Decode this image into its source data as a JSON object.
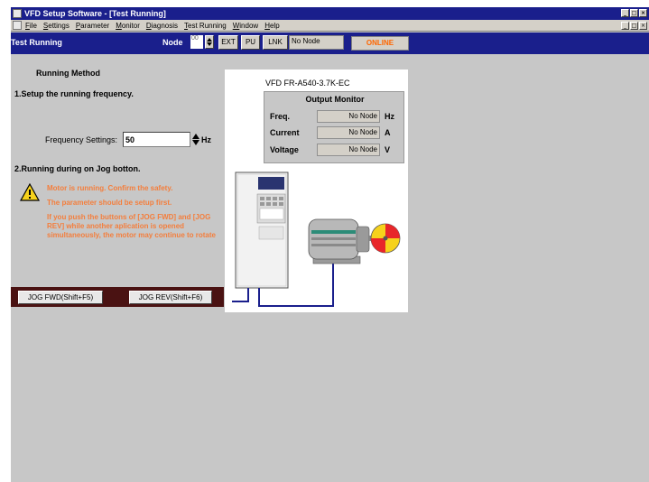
{
  "window": {
    "title": "VFD Setup Software - [Test Running]",
    "controls": [
      "_",
      "□",
      "×"
    ]
  },
  "menu": {
    "items": [
      "File",
      "Settings",
      "Parameter",
      "Monitor",
      "Diagnosis",
      "Test Running",
      "Window",
      "Help"
    ],
    "mdi_controls": [
      "_",
      "□",
      "×"
    ]
  },
  "toolbar": {
    "window_title": "Test Running",
    "node_label": "Node",
    "node_value": "00",
    "ext_label": "EXT",
    "pu_label": "PU",
    "lnk_label": "LNK",
    "node_status": "No Node",
    "online_label": "ONLINE"
  },
  "running": {
    "heading": "Running Method",
    "step1": "1.Setup the running frequency.",
    "freq_label": "Frequency Settings:",
    "freq_value": "50",
    "freq_unit": "Hz",
    "step2": "2.Running during on Jog botton.",
    "warnings": [
      "Motor is running. Confirm the safety.",
      "The parameter should be setup first.",
      "If you push the buttons of [JOG FWD] and [JOG REV] while another aplication is opened simultaneously, the motor may continue to rotate"
    ],
    "jog_fwd": "JOG FWD(Shift+F5)",
    "jog_rev": "JOG REV(Shift+F6)"
  },
  "monitor": {
    "model": "VFD FR-A540-3.7K-EC",
    "title": "Output Monitor",
    "rows": [
      {
        "label": "Freq.",
        "value": "No Node",
        "unit": "Hz"
      },
      {
        "label": "Current",
        "value": "No Node",
        "unit": "A"
      },
      {
        "label": "Voltage",
        "value": "No Node",
        "unit": "V"
      }
    ]
  },
  "colors": {
    "title_bar": "#1a1f8c",
    "warning_text": "#f47e3c",
    "online_text": "#ff6600",
    "jog_bar": "#4a1212",
    "wire": "#1a1f8c",
    "motor_fan_red": "#e8262a",
    "motor_fan_yellow": "#f6d21c"
  }
}
